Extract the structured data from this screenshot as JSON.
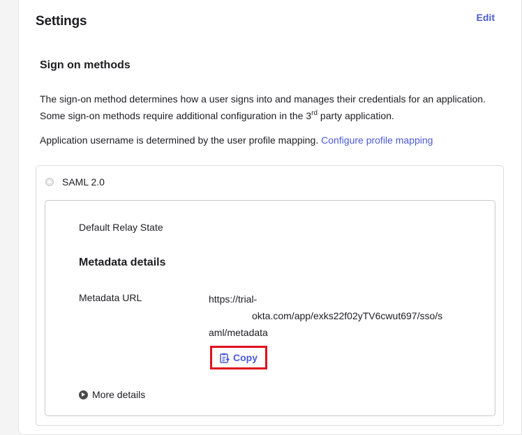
{
  "header": {
    "title": "Settings",
    "edit_label": "Edit"
  },
  "sign_on": {
    "title": "Sign on methods",
    "description_part1": "The sign-on method determines how a user signs into and manages their credentials for an application. Some sign-on methods require additional configuration in the 3",
    "description_sup": "rd",
    "description_part2": " party application.",
    "mapping_text": "Application username is determined by the user profile mapping. ",
    "mapping_link": "Configure profile mapping"
  },
  "saml": {
    "label": "SAML 2.0",
    "relay_state_label": "Default Relay State",
    "metadata_title": "Metadata details",
    "metadata_url_label": "Metadata URL",
    "metadata_url_line1": "https://trial-",
    "metadata_url_line2": "okta.com/app/exks22f02yTV6cwut697/sso/s",
    "metadata_url_line3": "aml/metadata",
    "copy_label": "Copy",
    "more_details_label": "More details"
  },
  "colors": {
    "accent": "#4a5ad4",
    "highlight": "#e0101f",
    "text": "#1d1d21"
  }
}
